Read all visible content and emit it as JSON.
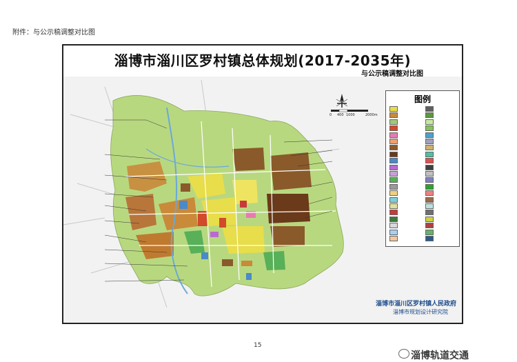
{
  "attachment_label": "附件：与公示稿调整对比图",
  "map_title": "淄博市淄川区罗村镇总体规划(2017-2035年)",
  "subtitle": "与公示稿调整对比图",
  "legend": {
    "title": "图例",
    "items": [
      {
        "color": "#e8dd4a"
      },
      {
        "color": "#c98a3a"
      },
      {
        "color": "#a0c878"
      },
      {
        "color": "#d14a2a"
      },
      {
        "color": "#e87ab0"
      },
      {
        "color": "#f0a070"
      },
      {
        "color": "#8a5a2a"
      },
      {
        "color": "#6a3a1a"
      },
      {
        "color": "#4a8ac8"
      },
      {
        "color": "#b86ad0"
      },
      {
        "color": "#c8a0d8"
      },
      {
        "color": "#58b058"
      },
      {
        "color": "#9a9a9a"
      },
      {
        "color": "#f0d080"
      },
      {
        "color": "#7ad0d8"
      },
      {
        "color": "#e0e0a0"
      },
      {
        "color": "#c83a3a"
      },
      {
        "color": "#3a7a3a"
      },
      {
        "color": "#d8d8d8"
      },
      {
        "color": "#a8d0f0"
      },
      {
        "color": "#f0c8a0"
      },
      {
        "color": "#606060"
      },
      {
        "color": "#5a9a3a"
      },
      {
        "color": "#c8e8a0"
      },
      {
        "color": "#88c060"
      },
      {
        "color": "#4aa0d0"
      },
      {
        "color": "#a0a0c0"
      },
      {
        "color": "#d0b070"
      },
      {
        "color": "#50c0a0"
      },
      {
        "color": "#e05050"
      },
      {
        "color": "#404040"
      },
      {
        "color": "#c0c0c0"
      },
      {
        "color": "#8080c0"
      },
      {
        "color": "#30a030"
      },
      {
        "color": "#f08080"
      },
      {
        "color": "#9a6a4a"
      },
      {
        "color": "#c0e0e0"
      },
      {
        "color": "#707070"
      },
      {
        "color": "#d0d040"
      },
      {
        "color": "#b04040"
      },
      {
        "color": "#6ab06a"
      },
      {
        "color": "#2a5a8a"
      }
    ]
  },
  "scale_bar": {
    "ticks": [
      "0",
      "400",
      "1000",
      "2000m"
    ]
  },
  "approval_block": {
    "org1": "淄博市淄川区罗村镇人民政府",
    "org2": "淄博市规划设计研究院"
  },
  "page_number": "15",
  "watermark": "淄博轨道交通",
  "colors": {
    "base_green": "#b8d880",
    "residential": "#e8dd4a",
    "industrial": "#8a5a2a",
    "commercial": "#d14a2a",
    "water": "#6aa8d8",
    "frame": "#222222"
  }
}
